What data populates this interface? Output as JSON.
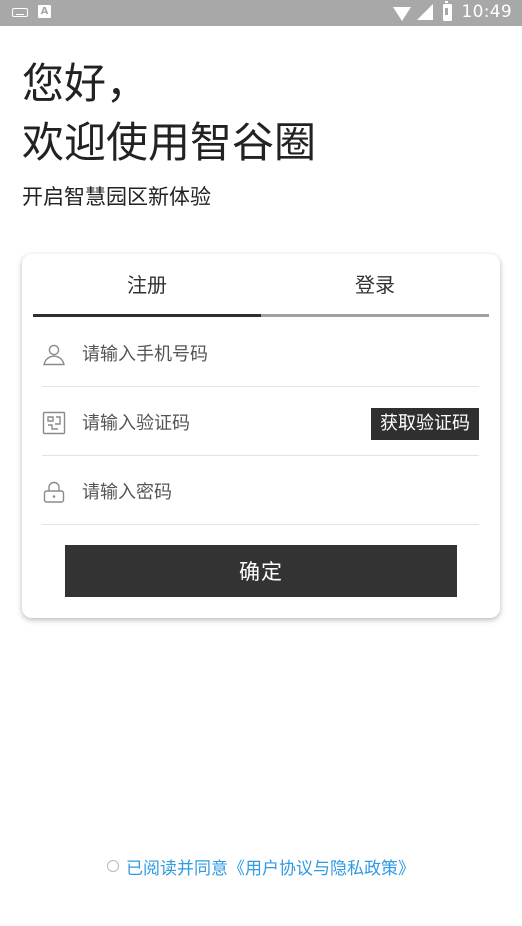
{
  "status_bar": {
    "time": "10:49",
    "left_icons": [
      "keyboard-icon",
      "a-notification-icon"
    ],
    "right_icons": [
      "wifi-icon",
      "signal-icon",
      "battery-icon"
    ],
    "a_icon_text": "A"
  },
  "greeting": {
    "line1": "您好，",
    "line2": "欢迎使用智谷圈",
    "subtitle": "开启智慧园区新体验"
  },
  "tabs": [
    {
      "label": "注册",
      "active": true
    },
    {
      "label": "登录",
      "active": false
    }
  ],
  "form": {
    "phone_placeholder": "请输入手机号码",
    "phone_icon": "user-icon",
    "code_placeholder": "请输入验证码",
    "code_icon": "verification-code-icon",
    "get_code_label": "获取验证码",
    "password_placeholder": "请输入密码",
    "password_icon": "lock-icon",
    "confirm_label": "确定"
  },
  "agreement": {
    "text": "已阅读并同意《用户协议与隐私政策》",
    "checked": false
  },
  "colors": {
    "status_bar_bg": "#a8a8a8",
    "dark_button": "#333333",
    "link_blue": "#2f9be3",
    "tab_active_line": "#2e2e2e"
  }
}
